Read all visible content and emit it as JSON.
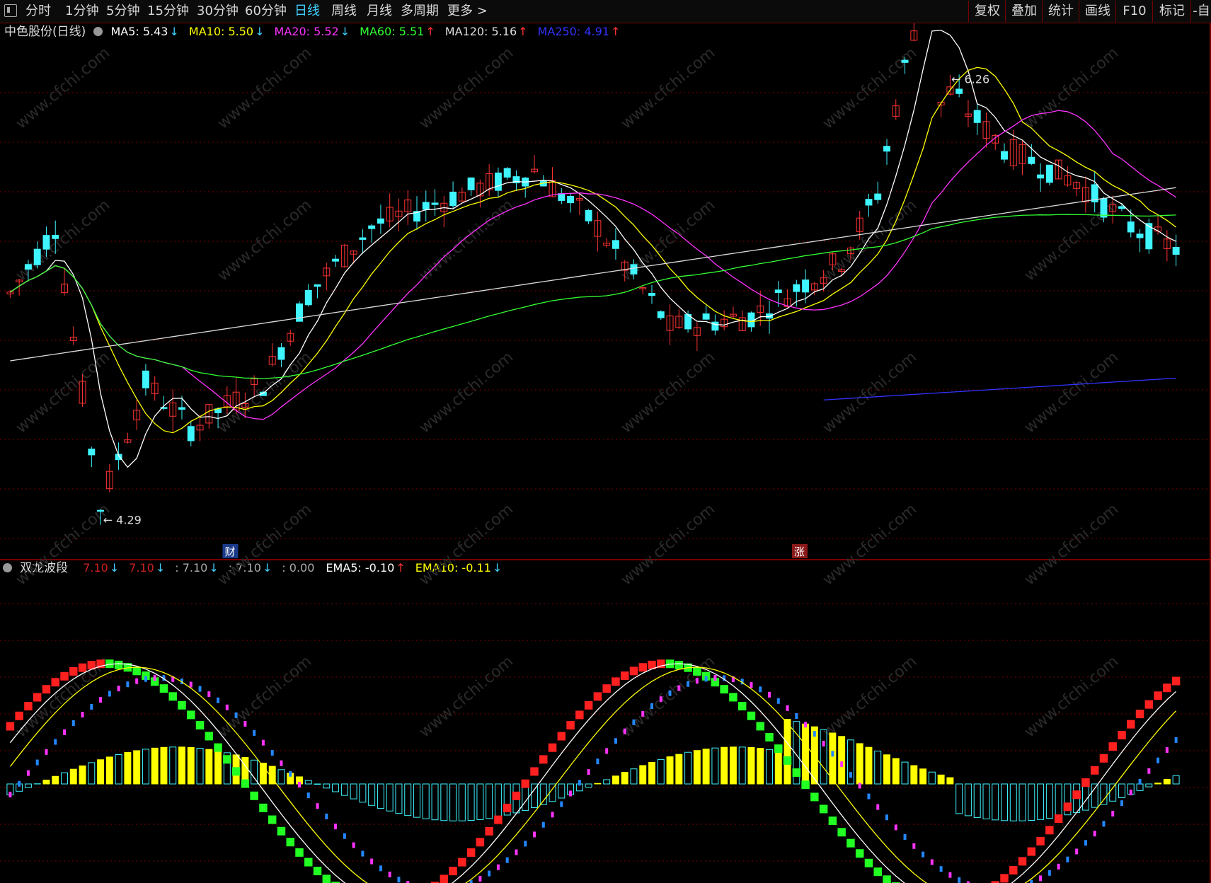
{
  "toolbar": {
    "periods": [
      "分时",
      "1分钟",
      "5分钟",
      "15分钟",
      "30分钟",
      "60分钟",
      "日线",
      "周线",
      "月线",
      "多周期",
      "更多 >"
    ],
    "active_period": "日线",
    "right_buttons": [
      "复权",
      "叠加",
      "统计",
      "画线",
      "F10",
      "标记",
      "-自"
    ]
  },
  "main_panel": {
    "stock_title": "中色股份(日线)",
    "indicators": [
      {
        "label": "MA5: 5.43",
        "arrow": "↓",
        "color": "#ffffff",
        "arrow_color": "#3fd2ff"
      },
      {
        "label": "MA10: 5.50",
        "arrow": "↓",
        "color": "#ffff00",
        "arrow_color": "#3fd2ff"
      },
      {
        "label": "MA20: 5.52",
        "arrow": "↓",
        "color": "#ff33ff",
        "arrow_color": "#3fd2ff"
      },
      {
        "label": "MA60: 5.51",
        "arrow": "↑",
        "color": "#33ff33",
        "arrow_color": "#ff3333"
      },
      {
        "label": "MA120: 5.16",
        "arrow": "↑",
        "color": "#dddddd",
        "arrow_color": "#ff3333"
      },
      {
        "label": "MA250: 4.91",
        "arrow": "↑",
        "color": "#3333ff",
        "arrow_color": "#ff3333"
      }
    ],
    "high_label": "6.26",
    "low_label": "4.29",
    "event_markers": [
      {
        "text": "财",
        "bg": "#1a3a8a"
      },
      {
        "text": "涨",
        "bg": "#8a1a1a"
      }
    ],
    "watermark": "www.cfchi.com"
  },
  "sub_panel": {
    "title": "双龙波段",
    "indicators": [
      {
        "label": "7.10",
        "arrow": "↓",
        "color": "#cc2222",
        "arrow_color": "#3fd2ff"
      },
      {
        "label": "7.10",
        "arrow": "↓",
        "color": "#cc2222",
        "arrow_color": "#3fd2ff"
      },
      {
        "label": ": 7.10",
        "arrow": "↓",
        "color": "#aaaaaa",
        "arrow_color": "#3fd2ff"
      },
      {
        "label": ": 7.10",
        "arrow": "↓",
        "color": "#aaaaaa",
        "arrow_color": "#3fd2ff"
      },
      {
        "label": ": 0.00",
        "arrow": "",
        "color": "#aaaaaa",
        "arrow_color": "#aaaaaa"
      },
      {
        "label": "EMA5: -0.10",
        "arrow": "↑",
        "color": "#ffffff",
        "arrow_color": "#ff3333"
      },
      {
        "label": "EMA10: -0.11",
        "arrow": "↓",
        "color": "#ffff00",
        "arrow_color": "#3fd2ff"
      }
    ]
  },
  "colors": {
    "up": "#ff3333",
    "down": "#3ff5ff",
    "grid": "#7a0000",
    "ma5": "#ffffff",
    "ma10": "#ffff00",
    "ma20": "#ff33ff",
    "ma60": "#33ff33",
    "ma120": "#dddddd",
    "ma250": "#3333ff"
  }
}
